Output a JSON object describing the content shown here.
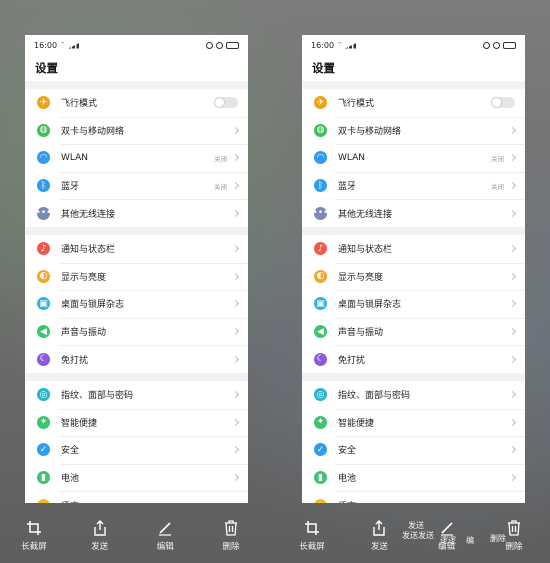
{
  "status": {
    "time": "16:00",
    "signal": "′′"
  },
  "page_title": "设置",
  "settings": [
    {
      "label": "飞行模式",
      "icon": "airplane-icon",
      "color": "#f0a21a",
      "control": "toggle"
    },
    {
      "label": "双卡与移动网络",
      "icon": "globe-icon",
      "color": "#3dbf5a",
      "control": "chevron"
    },
    {
      "label": "WLAN",
      "icon": "wifi-icon",
      "color": "#2e9df0",
      "control": "chevron",
      "value": "关闭"
    },
    {
      "label": "蓝牙",
      "icon": "bluetooth-icon",
      "color": "#2e9df0",
      "control": "chevron",
      "value": "关闭"
    },
    {
      "label": "其他无线连接",
      "icon": "more-icon",
      "color": "#7a8ab4",
      "control": "chevron"
    },
    {
      "label": "通知与状态栏",
      "icon": "bell-icon",
      "color": "#f05a48",
      "control": "chevron"
    },
    {
      "label": "显示与亮度",
      "icon": "brightness-icon",
      "color": "#f2a828",
      "control": "chevron"
    },
    {
      "label": "桌面与锁屏杂志",
      "icon": "picture-icon",
      "color": "#2ab4e8",
      "control": "chevron"
    },
    {
      "label": "声音与振动",
      "icon": "speaker-icon",
      "color": "#3dc470",
      "control": "chevron"
    },
    {
      "label": "免打扰",
      "icon": "moon-icon",
      "color": "#8a5ae0",
      "control": "chevron"
    },
    {
      "label": "指纹、面部与密码",
      "icon": "fingerprint-icon",
      "color": "#26b6c8",
      "control": "chevron"
    },
    {
      "label": "智能便捷",
      "icon": "smart-icon",
      "color": "#3dc470",
      "control": "chevron"
    },
    {
      "label": "安全",
      "icon": "shield-icon",
      "color": "#2e9df0",
      "control": "chevron"
    },
    {
      "label": "电池",
      "icon": "battery-icon",
      "color": "#3dc470",
      "control": "chevron"
    },
    {
      "label": "语言",
      "icon": "language-icon",
      "color": "#f0c020",
      "control": "partial"
    }
  ],
  "toolbar": {
    "left": [
      {
        "label": "长截屏",
        "icon": "crop-icon"
      },
      {
        "label": "发送",
        "icon": "share-icon"
      },
      {
        "label": "编辑",
        "icon": "pen-icon"
      },
      {
        "label": "删除",
        "icon": "trash-icon"
      }
    ],
    "right": [
      {
        "label": "长截屏",
        "icon": "crop-icon"
      },
      {
        "label": "发送",
        "icon": "share-icon"
      },
      {
        "label": "编辑",
        "icon": "pen-icon"
      },
      {
        "label": "删除",
        "icon": "trash-icon"
      }
    ],
    "overlay": {
      "send_top": "发送",
      "send_mid": "发送发送",
      "edit_top": "逻逻",
      "edit_b": "编",
      "delete_top": "删除"
    }
  }
}
